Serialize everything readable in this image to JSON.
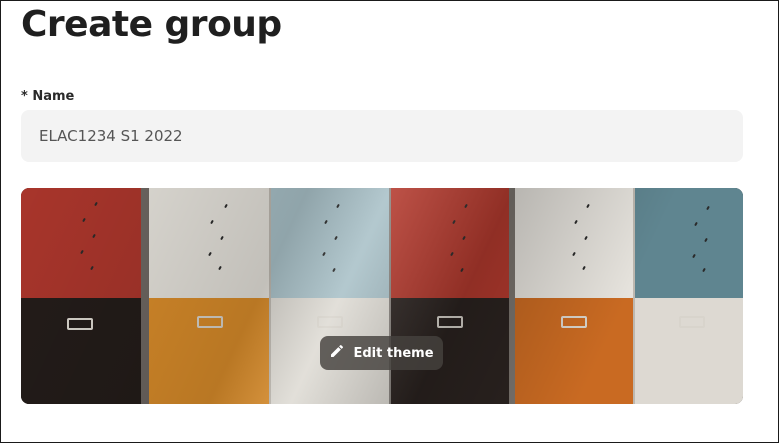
{
  "page": {
    "title": "Create group"
  },
  "form": {
    "name_label": "* Name",
    "name_value": "ELAC1234 S1 2022"
  },
  "theme": {
    "edit_label": "Edit theme",
    "edit_icon": "pencil-icon",
    "image_description_colors": {
      "red": "#a8352b",
      "cream": "#e4e1da",
      "blue": "#a9c1c8",
      "orange": "#d98c2a",
      "brown": "#2b2320",
      "teal": "#5f8590"
    }
  }
}
